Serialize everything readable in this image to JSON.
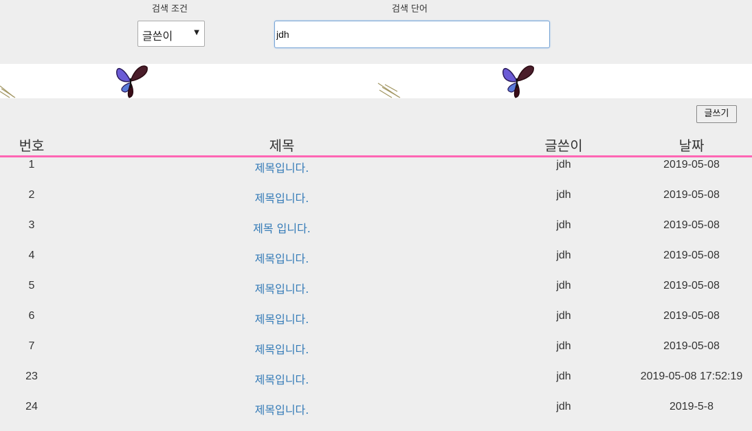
{
  "search": {
    "condition_label": "검색 조건",
    "keyword_label": "검색 단어",
    "condition_selected": "글쓴이",
    "keyword_value": "jdh"
  },
  "actions": {
    "write_label": "글쓰기"
  },
  "table": {
    "headers": {
      "no": "번호",
      "title": "제목",
      "author": "글쓴이",
      "date": "날짜"
    },
    "rows": [
      {
        "no": "1",
        "title": "제목입니다.",
        "author": "jdh",
        "date": "2019-05-08"
      },
      {
        "no": "2",
        "title": "제목입니다.",
        "author": "jdh",
        "date": "2019-05-08"
      },
      {
        "no": "3",
        "title": "제목 입니다.",
        "author": "jdh",
        "date": "2019-05-08"
      },
      {
        "no": "4",
        "title": "제목입니다.",
        "author": "jdh",
        "date": "2019-05-08"
      },
      {
        "no": "5",
        "title": "제목입니다.",
        "author": "jdh",
        "date": "2019-05-08"
      },
      {
        "no": "6",
        "title": "제목입니다.",
        "author": "jdh",
        "date": "2019-05-08"
      },
      {
        "no": "7",
        "title": "제목입니다.",
        "author": "jdh",
        "date": "2019-05-08"
      },
      {
        "no": "23",
        "title": "제목입니다.",
        "author": "jdh",
        "date": "2019-05-08 17:52:19"
      },
      {
        "no": "24",
        "title": "제목입니다.",
        "author": "jdh",
        "date": "2019-5-8"
      }
    ]
  },
  "colors": {
    "accent_line": "#ff66b3",
    "link": "#337ab7",
    "background": "#eeeeee"
  },
  "icons": {
    "banner": "butterfly-icon"
  }
}
